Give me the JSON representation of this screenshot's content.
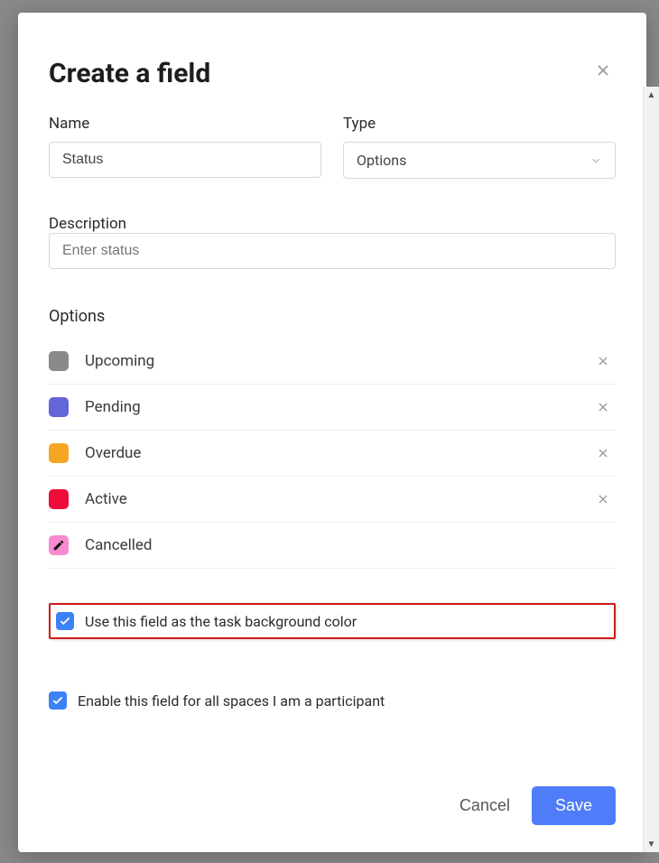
{
  "modal": {
    "title": "Create a field",
    "name_label": "Name",
    "name_value": "Status",
    "type_label": "Type",
    "type_value": "Options",
    "description_label": "Description",
    "description_placeholder": "Enter status",
    "options_label": "Options",
    "options": [
      {
        "label": "Upcoming",
        "color": "#8a8a8a",
        "removable": true
      },
      {
        "label": "Pending",
        "color": "#6366d8",
        "removable": true
      },
      {
        "label": "Overdue",
        "color": "#f5a623",
        "removable": true
      },
      {
        "label": "Active",
        "color": "#ed0c3a",
        "removable": true
      },
      {
        "label": "Cancelled",
        "color": "#f78ad1",
        "removable": false,
        "editing": true
      }
    ],
    "checkbox_bg_label": "Use this field as the task background color",
    "checkbox_bg_checked": true,
    "checkbox_spaces_label": "Enable this field for all spaces I am a participant",
    "checkbox_spaces_checked": true,
    "cancel_label": "Cancel",
    "save_label": "Save"
  }
}
